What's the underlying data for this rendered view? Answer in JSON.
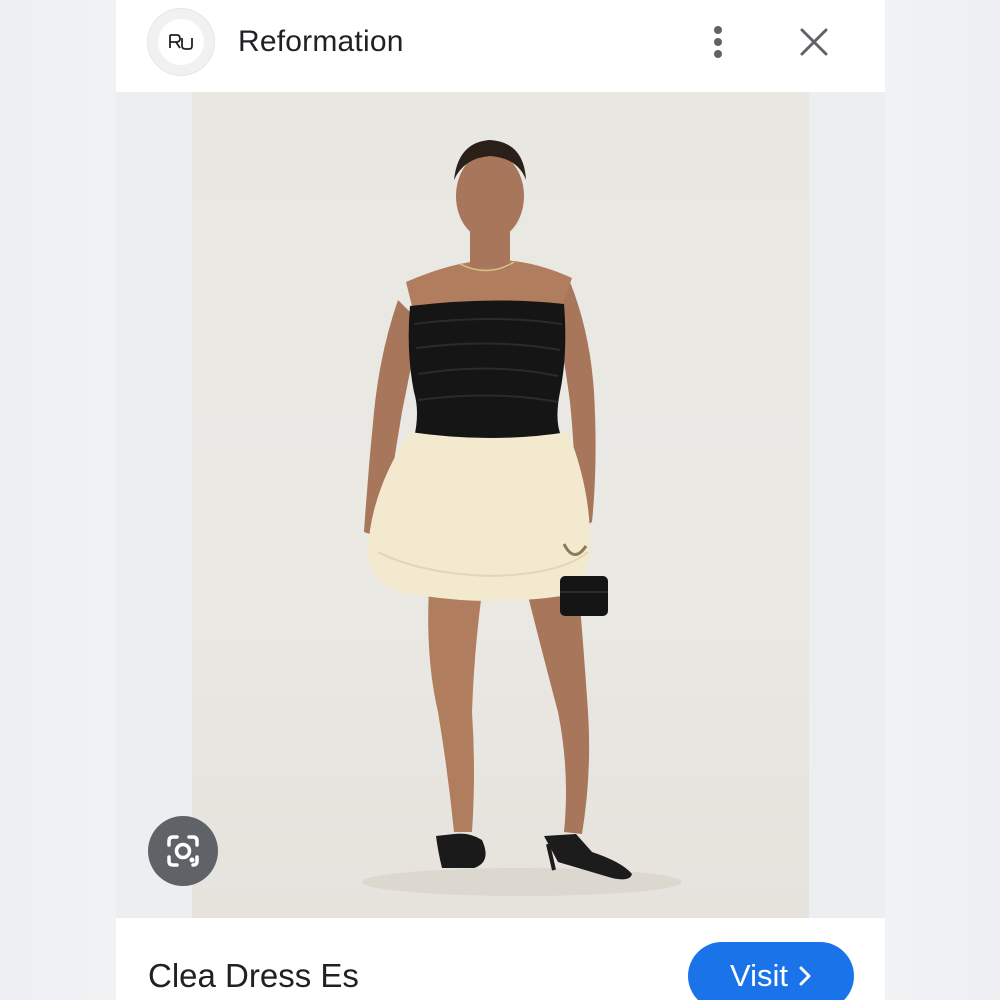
{
  "header": {
    "site_name": "Reformation",
    "logo_icon": "reformation-logo-icon",
    "more_icon": "more-vert-icon",
    "close_icon": "close-icon"
  },
  "image": {
    "description_icon": "product-photo",
    "lens_icon": "google-lens-icon"
  },
  "footer": {
    "product_title": "Clea Dress Es",
    "visit_label": "Visit",
    "visit_icon": "chevron-right-icon"
  },
  "colors": {
    "accent": "#1a73e8",
    "lens_button": "#5f6368",
    "text": "#202124"
  }
}
